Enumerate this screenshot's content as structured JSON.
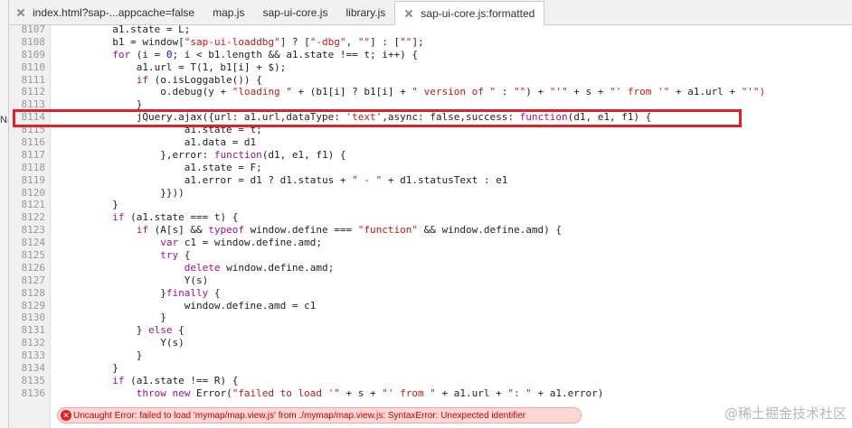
{
  "tabs": [
    {
      "label": "index.html?sap-...appcache=false",
      "closable": true,
      "active": false
    },
    {
      "label": "map.js",
      "closable": false,
      "active": false
    },
    {
      "label": "sap-ui-core.js",
      "closable": false,
      "active": false
    },
    {
      "label": "library.js",
      "closable": false,
      "active": false
    },
    {
      "label": "sap-ui-core.js:formatted",
      "closable": true,
      "active": true
    }
  ],
  "left_label": "Na",
  "colors": {
    "highlight": "#e0202a",
    "keyword": "#aa0d91",
    "string": "#c41a16",
    "number": "#1c00cf"
  },
  "code_lines": [
    {
      "n": "8107",
      "indent": 10,
      "parts": [
        [
          "t",
          "a1.state = L;"
        ]
      ]
    },
    {
      "n": "8108",
      "indent": 10,
      "parts": [
        [
          "t",
          "b1 = window["
        ],
        [
          "s",
          "\"sap-ui-loaddbg\""
        ],
        [
          "t",
          "] ? ["
        ],
        [
          "s",
          "\"-dbg\""
        ],
        [
          "t",
          ", "
        ],
        [
          "s",
          "\"\""
        ],
        [
          "t",
          "] : ["
        ],
        [
          "s",
          "\"\""
        ],
        [
          "t",
          "];"
        ]
      ]
    },
    {
      "n": "8109",
      "indent": 10,
      "parts": [
        [
          "k",
          "for"
        ],
        [
          "t",
          " (i = "
        ],
        [
          "n",
          "0"
        ],
        [
          "t",
          "; i < b1.length && a1.state !== t; i++) {"
        ]
      ]
    },
    {
      "n": "8110",
      "indent": 14,
      "parts": [
        [
          "t",
          "a1.url = T(1, b1[i] + $);"
        ]
      ]
    },
    {
      "n": "8111",
      "indent": 14,
      "parts": [
        [
          "k",
          "if"
        ],
        [
          "t",
          " (o.isLoggable()) {"
        ]
      ]
    },
    {
      "n": "8112",
      "indent": 18,
      "parts": [
        [
          "t",
          "o.debug(y + "
        ],
        [
          "s",
          "\"loading \""
        ],
        [
          "t",
          " + (b1[i] ? b1[i] + "
        ],
        [
          "s",
          "\" version of \""
        ],
        [
          "t",
          " : "
        ],
        [
          "s",
          "\"\""
        ],
        [
          "t",
          ") + "
        ],
        [
          "s",
          "\"'\""
        ],
        [
          "t",
          " + s + "
        ],
        [
          "s",
          "\"' from '\""
        ],
        [
          "t",
          " + a1.url + "
        ],
        [
          "s",
          "\"'\")"
        ]
      ]
    },
    {
      "n": "8113",
      "indent": 14,
      "parts": [
        [
          "t",
          "}"
        ]
      ]
    },
    {
      "n": "8114",
      "indent": 14,
      "parts": [
        [
          "t",
          "jQuery.ajax({url: a1.url,dataType: "
        ],
        [
          "s",
          "'text'"
        ],
        [
          "t",
          ",async: false,success: "
        ],
        [
          "k",
          "function"
        ],
        [
          "t",
          "(d1, e1, f1) {"
        ]
      ]
    },
    {
      "n": "8115",
      "indent": 22,
      "parts": [
        [
          "t",
          "a1.state = t;"
        ]
      ]
    },
    {
      "n": "8116",
      "indent": 22,
      "parts": [
        [
          "t",
          "a1.data = d1"
        ]
      ]
    },
    {
      "n": "8117",
      "indent": 18,
      "parts": [
        [
          "t",
          "},error: "
        ],
        [
          "k",
          "function"
        ],
        [
          "t",
          "(d1, e1, f1) {"
        ]
      ]
    },
    {
      "n": "8118",
      "indent": 22,
      "parts": [
        [
          "t",
          "a1.state = F;"
        ]
      ]
    },
    {
      "n": "8119",
      "indent": 22,
      "parts": [
        [
          "t",
          "a1.error = d1 ? d1.status + "
        ],
        [
          "s",
          "\" - \""
        ],
        [
          "t",
          " + d1.statusText : e1"
        ]
      ]
    },
    {
      "n": "8120",
      "indent": 18,
      "parts": [
        [
          "t",
          "}}))"
        ]
      ]
    },
    {
      "n": "8121",
      "indent": 10,
      "parts": [
        [
          "t",
          "}"
        ]
      ]
    },
    {
      "n": "8122",
      "indent": 10,
      "parts": [
        [
          "k",
          "if"
        ],
        [
          "t",
          " (a1.state === t) {"
        ]
      ]
    },
    {
      "n": "8123",
      "indent": 14,
      "parts": [
        [
          "k",
          "if"
        ],
        [
          "t",
          " (A[s] && "
        ],
        [
          "k",
          "typeof"
        ],
        [
          "t",
          " window.define === "
        ],
        [
          "s",
          "\"function\""
        ],
        [
          "t",
          " && window.define.amd) {"
        ]
      ]
    },
    {
      "n": "8124",
      "indent": 18,
      "parts": [
        [
          "k",
          "var"
        ],
        [
          "t",
          " c1 = window.define.amd;"
        ]
      ]
    },
    {
      "n": "8125",
      "indent": 18,
      "parts": [
        [
          "k",
          "try"
        ],
        [
          "t",
          " {"
        ]
      ]
    },
    {
      "n": "8126",
      "indent": 22,
      "parts": [
        [
          "k",
          "delete"
        ],
        [
          "t",
          " window.define.amd;"
        ]
      ]
    },
    {
      "n": "8127",
      "indent": 22,
      "parts": [
        [
          "t",
          "Y(s)"
        ]
      ]
    },
    {
      "n": "8128",
      "indent": 18,
      "parts": [
        [
          "t",
          "}"
        ],
        [
          "k",
          "finally"
        ],
        [
          "t",
          " {"
        ]
      ]
    },
    {
      "n": "8129",
      "indent": 22,
      "parts": [
        [
          "t",
          "window.define.amd = c1"
        ]
      ]
    },
    {
      "n": "8130",
      "indent": 18,
      "parts": [
        [
          "t",
          "}"
        ]
      ]
    },
    {
      "n": "8131",
      "indent": 14,
      "parts": [
        [
          "t",
          "} "
        ],
        [
          "k",
          "else"
        ],
        [
          "t",
          " {"
        ]
      ]
    },
    {
      "n": "8132",
      "indent": 18,
      "parts": [
        [
          "t",
          "Y(s)"
        ]
      ]
    },
    {
      "n": "8133",
      "indent": 14,
      "parts": [
        [
          "t",
          "}"
        ]
      ]
    },
    {
      "n": "8134",
      "indent": 10,
      "parts": [
        [
          "t",
          "}"
        ]
      ]
    },
    {
      "n": "8135",
      "indent": 10,
      "parts": [
        [
          "k",
          "if"
        ],
        [
          "t",
          " (a1.state !== R) {"
        ]
      ]
    },
    {
      "n": "8136",
      "indent": 14,
      "parts": [
        [
          "k",
          "throw new"
        ],
        [
          "t",
          " Error("
        ],
        [
          "s",
          "\"failed to load '\""
        ],
        [
          "t",
          " + s + "
        ],
        [
          "s",
          "\"' from \""
        ],
        [
          "t",
          " + a1.url + "
        ],
        [
          "s",
          "\": \""
        ],
        [
          "t",
          " + a1.error)"
        ]
      ]
    }
  ],
  "error_message": "Uncaught Error: failed to load 'mymap/map.view.js' from ./mymap/map.view.js: SyntaxError: Unexpected identifier",
  "watermark": "@稀土掘金技术社区"
}
